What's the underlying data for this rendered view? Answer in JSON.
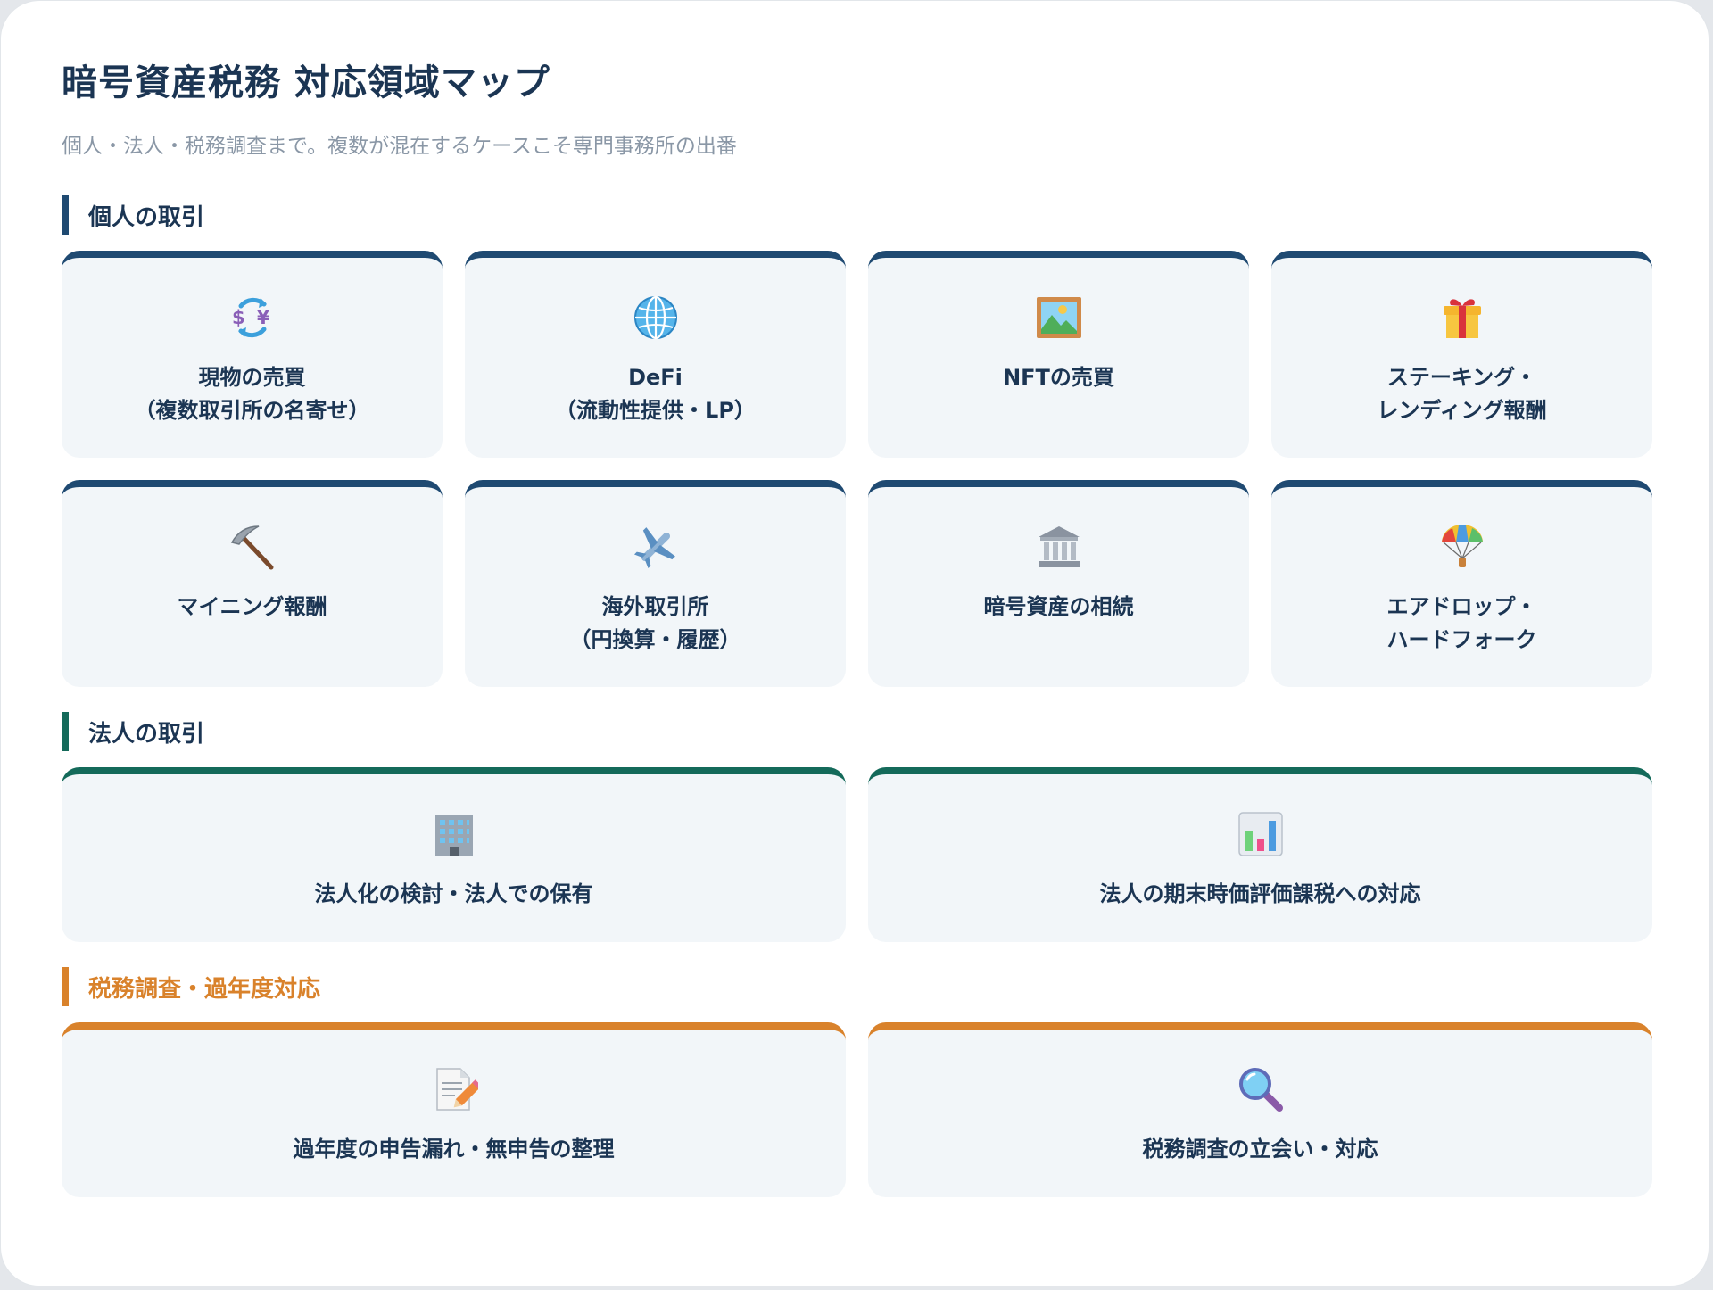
{
  "title": "暗号資産税務 対応領域マップ",
  "subtitle": "個人・法人・税務調査まで。複数が混在するケースこそ専門事務所の出番",
  "colors": {
    "navy": "#1f4a72",
    "green": "#146a5a",
    "orange": "#d9822b",
    "card_bg": "#f2f6f9",
    "heading": "#1b3553"
  },
  "sections": {
    "personal": {
      "heading": "個人の取引",
      "cards": [
        {
          "icon": "currency-exchange-icon",
          "lines": [
            "現物の売買",
            "（複数取引所の名寄せ）"
          ]
        },
        {
          "icon": "globe-icon",
          "lines": [
            "DeFi",
            "（流動性提供・LP）"
          ]
        },
        {
          "icon": "framed-picture-icon",
          "lines": [
            "NFTの売買"
          ]
        },
        {
          "icon": "gift-icon",
          "lines": [
            "ステーキング・",
            "レンディング報酬"
          ]
        },
        {
          "icon": "pickaxe-icon",
          "lines": [
            "マイニング報酬"
          ]
        },
        {
          "icon": "airplane-icon",
          "lines": [
            "海外取引所",
            "（円換算・履歴）"
          ]
        },
        {
          "icon": "bank-building-icon",
          "lines": [
            "暗号資産の相続"
          ]
        },
        {
          "icon": "parachute-icon",
          "lines": [
            "エアドロップ・",
            "ハードフォーク"
          ]
        }
      ]
    },
    "corporate": {
      "heading": "法人の取引",
      "cards": [
        {
          "icon": "office-building-icon",
          "lines": [
            "法人化の検討・法人での保有"
          ]
        },
        {
          "icon": "bar-chart-icon",
          "lines": [
            "法人の期末時価評価課税への対応"
          ]
        }
      ]
    },
    "audit": {
      "heading": "税務調査・過年度対応",
      "cards": [
        {
          "icon": "memo-pencil-icon",
          "lines": [
            "過年度の申告漏れ・無申告の整理"
          ]
        },
        {
          "icon": "magnifying-glass-icon",
          "lines": [
            "税務調査の立会い・対応"
          ]
        }
      ]
    }
  }
}
